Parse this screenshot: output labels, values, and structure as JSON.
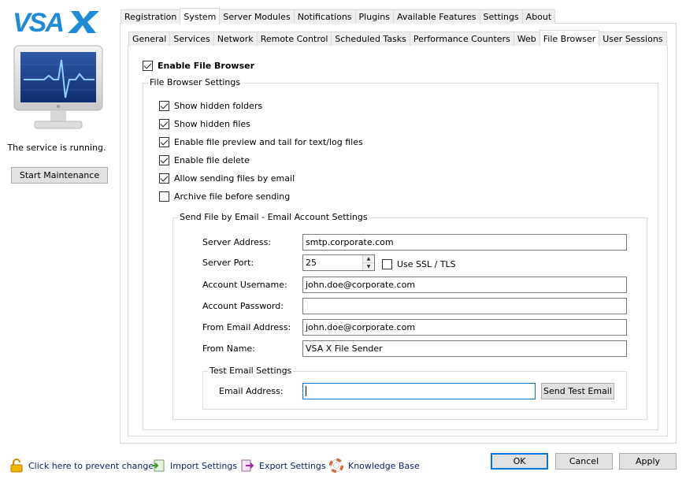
{
  "brand": {
    "logo_text": "VSAX",
    "accent": "#1f8bd6"
  },
  "left_panel": {
    "status_text": "The service is running.",
    "maintenance_button": "Start Maintenance"
  },
  "main_tabs": [
    "Registration",
    "System",
    "Server Modules",
    "Notifications",
    "Plugins",
    "Available Features",
    "Settings",
    "About"
  ],
  "main_tab_active": "System",
  "sub_tabs": [
    "General",
    "Services",
    "Network",
    "Remote Control",
    "Scheduled Tasks",
    "Performance Counters",
    "Web",
    "File Browser",
    "User Sessions"
  ],
  "sub_tab_active": "File Browser",
  "enable_file_browser": {
    "label": "Enable File Browser",
    "checked": true
  },
  "file_browser_settings": {
    "title": "File Browser Settings",
    "options": [
      {
        "label": "Show hidden folders",
        "checked": true
      },
      {
        "label": "Show hidden files",
        "checked": true
      },
      {
        "label": "Enable file preview and tail for text/log files",
        "checked": true
      },
      {
        "label": "Enable file delete",
        "checked": true
      },
      {
        "label": "Allow sending files by email",
        "checked": true
      },
      {
        "label": "Archive file before sending",
        "checked": false
      }
    ]
  },
  "email_settings": {
    "title": "Send File by Email - Email Account Settings",
    "server_address_label": "Server Address:",
    "server_address": "smtp.corporate.com",
    "server_port_label": "Server Port:",
    "server_port": "25",
    "use_ssl_label": "Use SSL / TLS",
    "use_ssl_checked": false,
    "username_label": "Account Username:",
    "username": "john.doe@corporate.com",
    "password_label": "Account Password:",
    "password": "",
    "from_email_label": "From Email Address:",
    "from_email": "john.doe@corporate.com",
    "from_name_label": "From Name:",
    "from_name": "VSA X File Sender"
  },
  "test_email": {
    "title": "Test Email Settings",
    "email_label": "Email Address:",
    "email_value": "",
    "send_button": "Send Test Email"
  },
  "footer": {
    "prevent_changes": "Click here to prevent changes",
    "import_settings": "Import Settings",
    "export_settings": "Export Settings",
    "knowledge_base": "Knowledge Base",
    "ok": "OK",
    "cancel": "Cancel",
    "apply": "Apply"
  }
}
